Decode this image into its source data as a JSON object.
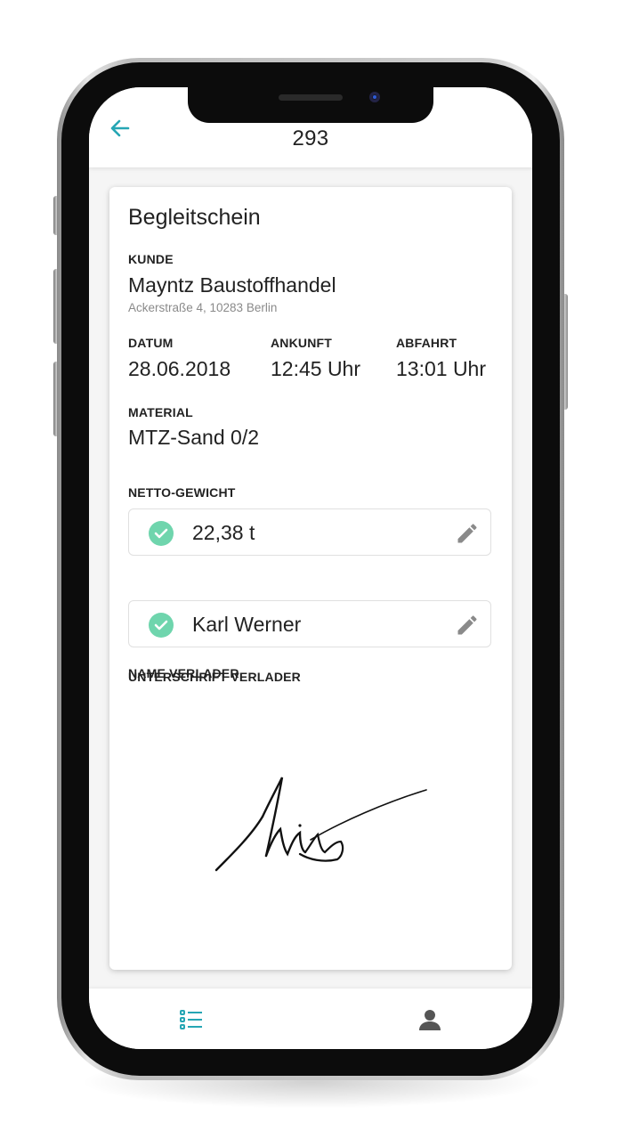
{
  "header": {
    "title": "293",
    "back_icon": "arrow-left-icon"
  },
  "card": {
    "title": "Begleitschein",
    "customer": {
      "label": "KUNDE",
      "name": "Mayntz Baustoffhandel",
      "address": "Ackerstraße 4, 10283 Berlin"
    },
    "date": {
      "label": "DATUM",
      "value": "28.06.2018"
    },
    "arrival": {
      "label": "ANKUNFT",
      "value": "12:45 Uhr"
    },
    "departure": {
      "label": "ABFAHRT",
      "value": "13:01 Uhr"
    },
    "material": {
      "label": "MATERIAL",
      "value": "MTZ-Sand 0/2"
    },
    "net_weight": {
      "label": "NETTO-GEWICHT",
      "value": "22,38 t",
      "status_icon": "check-circle-icon",
      "edit_icon": "pencil-icon"
    },
    "loader_name": {
      "label": "NAME VERLADER",
      "value": "Karl Werner",
      "status_icon": "check-circle-icon",
      "edit_icon": "pencil-icon"
    },
    "signature": {
      "label": "UNTERSCHRIFT VERLADER"
    }
  },
  "bottom_nav": {
    "items": [
      {
        "icon": "list-icon",
        "active": true
      },
      {
        "icon": "person-icon",
        "active": false
      }
    ]
  },
  "colors": {
    "accent": "#26a6b4",
    "success": "#6fd5ad",
    "icon_gray": "#8a8a8a",
    "text": "#222222"
  }
}
